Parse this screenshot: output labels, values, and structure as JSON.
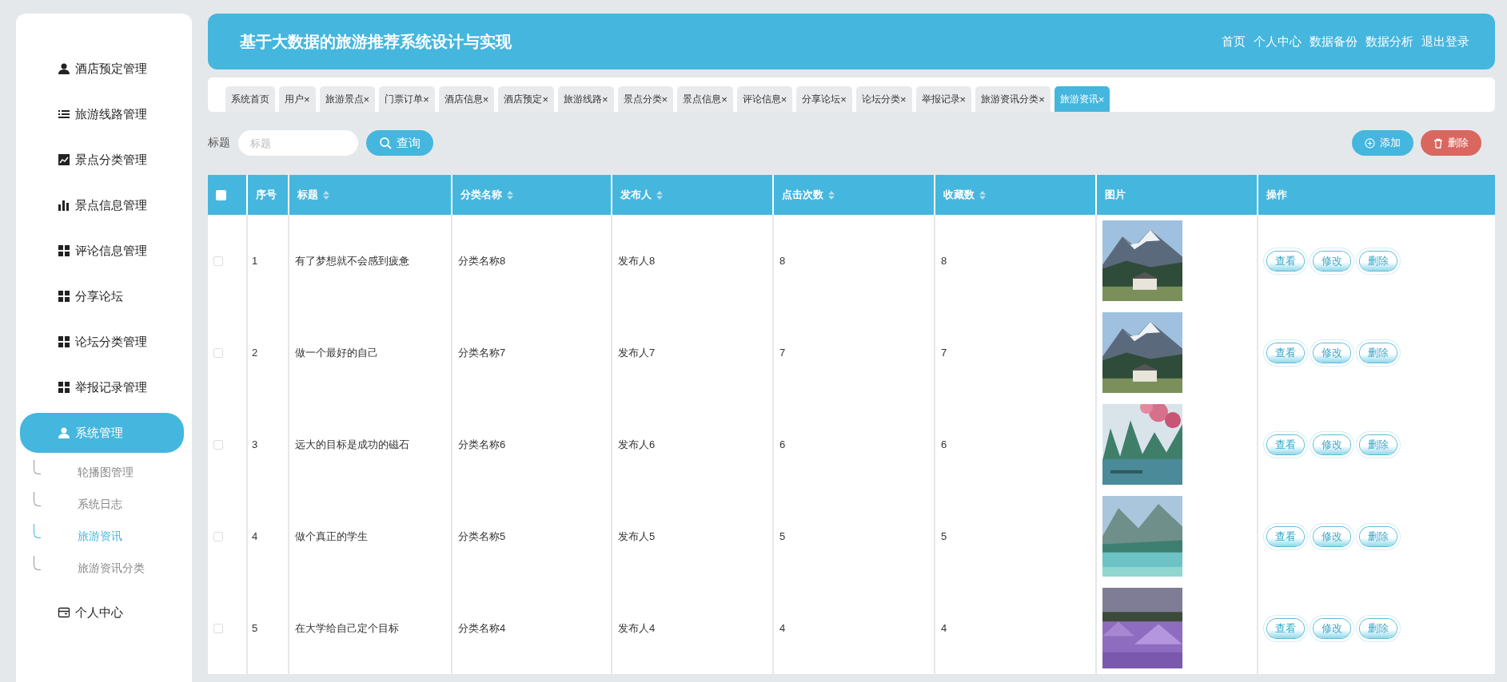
{
  "header": {
    "title": "基于大数据的旅游推荐系统设计与实现",
    "nav": [
      "首页",
      "个人中心",
      "数据备份",
      "数据分析",
      "退出登录"
    ]
  },
  "sidebar": {
    "items": [
      {
        "label": "酒店预定管理",
        "selected": false
      },
      {
        "label": "旅游线路管理",
        "selected": false
      },
      {
        "label": "景点分类管理",
        "selected": false
      },
      {
        "label": "景点信息管理",
        "selected": false
      },
      {
        "label": "评论信息管理",
        "selected": false
      },
      {
        "label": "分享论坛",
        "selected": false
      },
      {
        "label": "论坛分类管理",
        "selected": false
      },
      {
        "label": "举报记录管理",
        "selected": false
      },
      {
        "label": "系统管理",
        "selected": true,
        "children": [
          {
            "label": "轮播图管理",
            "selected": false
          },
          {
            "label": "系统日志",
            "selected": false
          },
          {
            "label": "旅游资讯",
            "selected": true
          },
          {
            "label": "旅游资讯分类",
            "selected": false
          }
        ]
      },
      {
        "label": "个人中心",
        "selected": false
      }
    ]
  },
  "tabs": [
    {
      "label": "系统首页",
      "selected": false
    },
    {
      "label": "用户",
      "close": "×",
      "selected": false
    },
    {
      "label": "旅游景点",
      "close": "×",
      "selected": false
    },
    {
      "label": "门票订单",
      "close": "×",
      "selected": false
    },
    {
      "label": "酒店信息",
      "close": "×",
      "selected": false
    },
    {
      "label": "酒店预定",
      "close": "×",
      "selected": false
    },
    {
      "label": "旅游线路",
      "close": "×",
      "selected": false
    },
    {
      "label": "景点分类",
      "close": "×",
      "selected": false
    },
    {
      "label": "景点信息",
      "close": "×",
      "selected": false
    },
    {
      "label": "评论信息",
      "close": "×",
      "selected": false
    },
    {
      "label": "分享论坛",
      "close": "×",
      "selected": false
    },
    {
      "label": "论坛分类",
      "close": "×",
      "selected": false
    },
    {
      "label": "举报记录",
      "close": "×",
      "selected": false
    },
    {
      "label": "旅游资讯分类",
      "close": "×",
      "selected": false
    },
    {
      "label": "旅游资讯",
      "close": "×",
      "selected": true
    }
  ],
  "toolbar": {
    "search_label": "标题",
    "search_placeholder": "标题",
    "search_button": "查询",
    "add_button": "添加",
    "delete_button": "删除"
  },
  "table": {
    "select_all": {
      "checked": false
    },
    "columns": [
      {
        "label": "序号",
        "sortable": false
      },
      {
        "label": "标题",
        "sortable": true
      },
      {
        "label": "分类名称",
        "sortable": true
      },
      {
        "label": "发布人",
        "sortable": true
      },
      {
        "label": "点击次数",
        "sortable": true
      },
      {
        "label": "收藏数",
        "sortable": true
      },
      {
        "label": "图片",
        "sortable": false
      },
      {
        "label": "操作",
        "sortable": false
      }
    ],
    "rows": [
      {
        "checked": false,
        "cells": [
          "1",
          "有了梦想就不会感到疲惫",
          "分类名称8",
          "发布人8",
          "8",
          "8"
        ],
        "actions": [
          "查看",
          "修改",
          "删除"
        ]
      },
      {
        "checked": false,
        "cells": [
          "2",
          "做一个最好的自己",
          "分类名称7",
          "发布人7",
          "7",
          "7"
        ],
        "actions": [
          "查看",
          "修改",
          "删除"
        ]
      },
      {
        "checked": false,
        "cells": [
          "3",
          "远大的目标是成功的磁石",
          "分类名称6",
          "发布人6",
          "6",
          "6"
        ],
        "actions": [
          "查看",
          "修改",
          "删除"
        ]
      },
      {
        "checked": false,
        "cells": [
          "4",
          "做个真正的学生",
          "分类名称5",
          "发布人5",
          "5",
          "5"
        ],
        "actions": [
          "查看",
          "修改",
          "删除"
        ]
      },
      {
        "checked": false,
        "cells": [
          "5",
          "在大学给自己定个目标",
          "分类名称4",
          "发布人4",
          "4",
          "4"
        ],
        "actions": [
          "查看",
          "修改",
          "删除"
        ]
      }
    ]
  }
}
